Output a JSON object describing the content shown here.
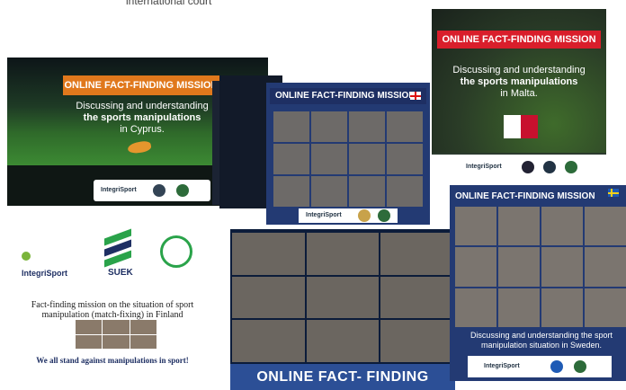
{
  "top_caption": "international court",
  "cards": {
    "cyprus": {
      "banner": "ONLINE FACT-FINDING MISSION",
      "line1": "Discussing and understanding",
      "line2": "the sports manipulations",
      "line3": "in Cyprus.",
      "logo": "IntegriSport"
    },
    "georgia": {
      "banner": "ONLINE FACT-FINDING MISSION",
      "logo": "IntegriSport"
    },
    "malta": {
      "banner": "ONLINE FACT-FINDING MISSION",
      "line1": "Discussing and understanding",
      "line2": "the sports manipulations",
      "line3": "in Malta.",
      "logo": "IntegriSport"
    },
    "finland": {
      "logo1": "IntegriSport",
      "logo2": "SUEK",
      "text": "Fact-finding mission on the situation of sport manipulation (match-fixing) in Finland",
      "footer": "We all stand against manipulations in sport!"
    },
    "big": {
      "banner": "ONLINE FACT- FINDING MISSION"
    },
    "sweden": {
      "banner": "ONLINE FACT-FINDING MISSION",
      "text": "Discussing and understanding the sport manipulation situation in Sweden.",
      "logo": "IntegriSport"
    }
  },
  "colors": {
    "orange_banner": "#e0781c",
    "red_banner": "#d91e2b",
    "navy_card": "#233a73",
    "blue_banner": "#2c4f96"
  }
}
